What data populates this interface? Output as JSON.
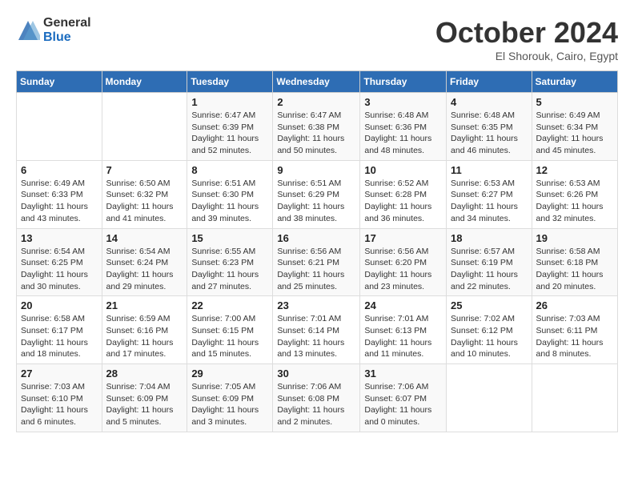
{
  "logo": {
    "general": "General",
    "blue": "Blue"
  },
  "title": "October 2024",
  "location": "El Shorouk, Cairo, Egypt",
  "weekdays": [
    "Sunday",
    "Monday",
    "Tuesday",
    "Wednesday",
    "Thursday",
    "Friday",
    "Saturday"
  ],
  "weeks": [
    [
      {
        "day": "",
        "info": ""
      },
      {
        "day": "",
        "info": ""
      },
      {
        "day": "1",
        "info": "Sunrise: 6:47 AM\nSunset: 6:39 PM\nDaylight: 11 hours and 52 minutes."
      },
      {
        "day": "2",
        "info": "Sunrise: 6:47 AM\nSunset: 6:38 PM\nDaylight: 11 hours and 50 minutes."
      },
      {
        "day": "3",
        "info": "Sunrise: 6:48 AM\nSunset: 6:36 PM\nDaylight: 11 hours and 48 minutes."
      },
      {
        "day": "4",
        "info": "Sunrise: 6:48 AM\nSunset: 6:35 PM\nDaylight: 11 hours and 46 minutes."
      },
      {
        "day": "5",
        "info": "Sunrise: 6:49 AM\nSunset: 6:34 PM\nDaylight: 11 hours and 45 minutes."
      }
    ],
    [
      {
        "day": "6",
        "info": "Sunrise: 6:49 AM\nSunset: 6:33 PM\nDaylight: 11 hours and 43 minutes."
      },
      {
        "day": "7",
        "info": "Sunrise: 6:50 AM\nSunset: 6:32 PM\nDaylight: 11 hours and 41 minutes."
      },
      {
        "day": "8",
        "info": "Sunrise: 6:51 AM\nSunset: 6:30 PM\nDaylight: 11 hours and 39 minutes."
      },
      {
        "day": "9",
        "info": "Sunrise: 6:51 AM\nSunset: 6:29 PM\nDaylight: 11 hours and 38 minutes."
      },
      {
        "day": "10",
        "info": "Sunrise: 6:52 AM\nSunset: 6:28 PM\nDaylight: 11 hours and 36 minutes."
      },
      {
        "day": "11",
        "info": "Sunrise: 6:53 AM\nSunset: 6:27 PM\nDaylight: 11 hours and 34 minutes."
      },
      {
        "day": "12",
        "info": "Sunrise: 6:53 AM\nSunset: 6:26 PM\nDaylight: 11 hours and 32 minutes."
      }
    ],
    [
      {
        "day": "13",
        "info": "Sunrise: 6:54 AM\nSunset: 6:25 PM\nDaylight: 11 hours and 30 minutes."
      },
      {
        "day": "14",
        "info": "Sunrise: 6:54 AM\nSunset: 6:24 PM\nDaylight: 11 hours and 29 minutes."
      },
      {
        "day": "15",
        "info": "Sunrise: 6:55 AM\nSunset: 6:23 PM\nDaylight: 11 hours and 27 minutes."
      },
      {
        "day": "16",
        "info": "Sunrise: 6:56 AM\nSunset: 6:21 PM\nDaylight: 11 hours and 25 minutes."
      },
      {
        "day": "17",
        "info": "Sunrise: 6:56 AM\nSunset: 6:20 PM\nDaylight: 11 hours and 23 minutes."
      },
      {
        "day": "18",
        "info": "Sunrise: 6:57 AM\nSunset: 6:19 PM\nDaylight: 11 hours and 22 minutes."
      },
      {
        "day": "19",
        "info": "Sunrise: 6:58 AM\nSunset: 6:18 PM\nDaylight: 11 hours and 20 minutes."
      }
    ],
    [
      {
        "day": "20",
        "info": "Sunrise: 6:58 AM\nSunset: 6:17 PM\nDaylight: 11 hours and 18 minutes."
      },
      {
        "day": "21",
        "info": "Sunrise: 6:59 AM\nSunset: 6:16 PM\nDaylight: 11 hours and 17 minutes."
      },
      {
        "day": "22",
        "info": "Sunrise: 7:00 AM\nSunset: 6:15 PM\nDaylight: 11 hours and 15 minutes."
      },
      {
        "day": "23",
        "info": "Sunrise: 7:01 AM\nSunset: 6:14 PM\nDaylight: 11 hours and 13 minutes."
      },
      {
        "day": "24",
        "info": "Sunrise: 7:01 AM\nSunset: 6:13 PM\nDaylight: 11 hours and 11 minutes."
      },
      {
        "day": "25",
        "info": "Sunrise: 7:02 AM\nSunset: 6:12 PM\nDaylight: 11 hours and 10 minutes."
      },
      {
        "day": "26",
        "info": "Sunrise: 7:03 AM\nSunset: 6:11 PM\nDaylight: 11 hours and 8 minutes."
      }
    ],
    [
      {
        "day": "27",
        "info": "Sunrise: 7:03 AM\nSunset: 6:10 PM\nDaylight: 11 hours and 6 minutes."
      },
      {
        "day": "28",
        "info": "Sunrise: 7:04 AM\nSunset: 6:09 PM\nDaylight: 11 hours and 5 minutes."
      },
      {
        "day": "29",
        "info": "Sunrise: 7:05 AM\nSunset: 6:09 PM\nDaylight: 11 hours and 3 minutes."
      },
      {
        "day": "30",
        "info": "Sunrise: 7:06 AM\nSunset: 6:08 PM\nDaylight: 11 hours and 2 minutes."
      },
      {
        "day": "31",
        "info": "Sunrise: 7:06 AM\nSunset: 6:07 PM\nDaylight: 11 hours and 0 minutes."
      },
      {
        "day": "",
        "info": ""
      },
      {
        "day": "",
        "info": ""
      }
    ]
  ]
}
